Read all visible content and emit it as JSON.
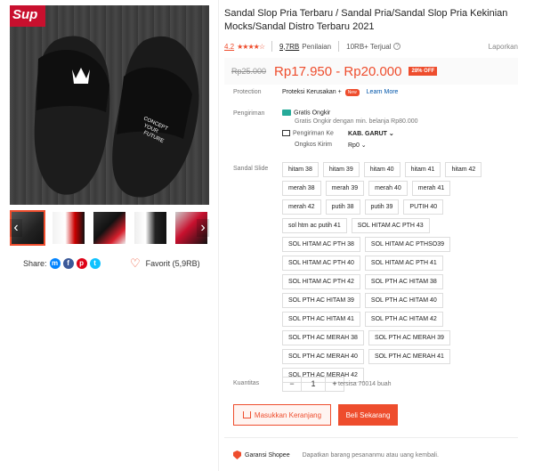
{
  "gallery": {
    "brand_text": "Sup",
    "print_text": "CONCEPT YOUR FUTURE",
    "prev_arrow": "‹",
    "next_arrow": "›",
    "thumbs": [
      "thumb-1",
      "thumb-2",
      "thumb-3",
      "thumb-4",
      "thumb-5"
    ]
  },
  "share": {
    "label": "Share:",
    "icons": [
      "messenger-icon",
      "facebook-icon",
      "pinterest-icon",
      "twitter-icon"
    ],
    "favorite_label": "Favorit (5,9RB)"
  },
  "product": {
    "title": "Sandal Slop Pria Terbaru / Sandal Pria/Sandal Slop Pria Kekinian Mocks/Sandal Distro Terbaru 2021",
    "rating": "4.2",
    "stars": "★★★★☆",
    "ratings_count": "9,7RB",
    "ratings_label": "Penilaian",
    "sold": "10RB+ Terjual",
    "report": "Laporkan",
    "old_price": "Rp25.000",
    "price": "Rp17.950 - Rp20.000",
    "discount": "28% OFF"
  },
  "protection": {
    "label": "Protection",
    "value": "Proteksi Kerusakan +",
    "badge": "New",
    "link": "Learn More"
  },
  "shipping": {
    "label": "Pengiriman",
    "free": "Gratis Ongkir",
    "free_desc": "Gratis Ongkir dengan min. belanja Rp80.000",
    "to_label": "Pengiriman Ke",
    "to_value": "KAB. GARUT",
    "cost_label": "Ongkos Kirim",
    "cost_value": "Rp0"
  },
  "variants": {
    "label": "Sandal Slide",
    "options": [
      "hitam 38",
      "hitam 39",
      "hitam 40",
      "hitam 41",
      "hitam 42",
      "merah 38",
      "merah 39",
      "merah 40",
      "merah 41",
      "merah 42",
      "putih 38",
      "putih 39",
      "PUTIH 40",
      "sol htm ac putih 41",
      "SOL HITAM AC PTH 43",
      "SOL HITAM AC PTH 38",
      "SOL HITAM AC PTHSO39",
      "SOL HITAM AC PTH 40",
      "SOL HITAM AC PTH 41",
      "SOL HITAM AC PTH 42",
      "SOL PTH AC HITAM 38",
      "SOL PTH AC HITAM 39",
      "SOL PTH AC HITAM 40",
      "SOL PTH AC HITAM 41",
      "SOL PTH AC HITAM 42",
      "SOL PTH AC MERAH 38",
      "SOL PTH AC MERAH 39",
      "SOL PTH AC MERAH 40",
      "SOL PTH AC MERAH 41",
      "SOL PTH AC MERAH 42"
    ]
  },
  "quantity": {
    "label": "Kuantitas",
    "minus": "−",
    "value": "1",
    "plus": "+",
    "stock": "tersisa 70014 buah"
  },
  "actions": {
    "add_to_cart": "Masukkan Keranjang",
    "buy_now": "Beli Sekarang"
  },
  "guarantee": {
    "title": "Garansi Shopee",
    "desc": "Dapatkan barang pesananmu atau uang kembali."
  },
  "colors": {
    "accent": "#ee4d2d",
    "teal": "#26aa99"
  }
}
